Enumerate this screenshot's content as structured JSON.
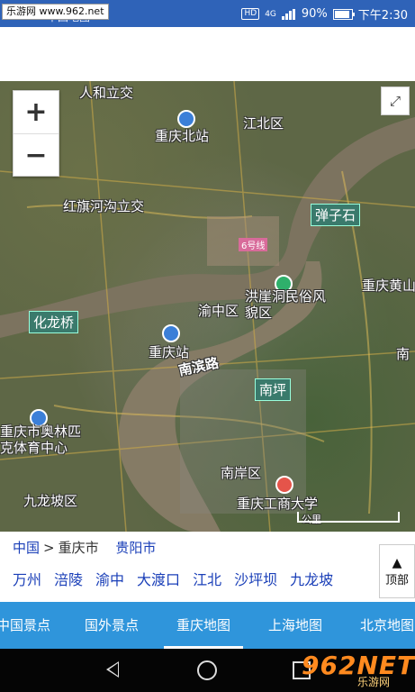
{
  "status_bar": {
    "watermark": "乐游网 www.962.net",
    "app_title": "中国地图",
    "network": "4G",
    "battery": "90%",
    "time": "下午2:30",
    "bg_color": "#2f63b8"
  },
  "map": {
    "zoom_in": "+",
    "zoom_out": "−",
    "labels": [
      "人和立交",
      "重庆北站",
      "江北区",
      "红旗河沟立交",
      "弹子石",
      "6号线",
      "重庆黄山",
      "化龙桥",
      "洪崖洞民俗风貌区",
      "渝中区",
      "重庆站",
      "南滨路",
      "南",
      "南坪",
      "重庆市奥林匹克体育中心",
      "南岸区",
      "重庆工商大学",
      "九龙坡区",
      "公里"
    ]
  },
  "breadcrumb": {
    "root": "中国",
    "separator": ">",
    "current": "重庆市",
    "sibling": "贵阳市"
  },
  "districts": [
    "万州",
    "涪陵",
    "渝中",
    "大渡口",
    "江北",
    "沙坪坝",
    "九龙坡"
  ],
  "back_to_top": {
    "arrow": "▲",
    "label": "顶部"
  },
  "tabs": [
    "中国景点",
    "国外景点",
    "重庆地图",
    "上海地图",
    "北京地图"
  ],
  "active_tab": "重庆地图",
  "logo": {
    "big": "962NET",
    "small": "乐游网"
  },
  "colors": {
    "tab_bar": "#2f95db",
    "link": "#1a3fb8"
  }
}
